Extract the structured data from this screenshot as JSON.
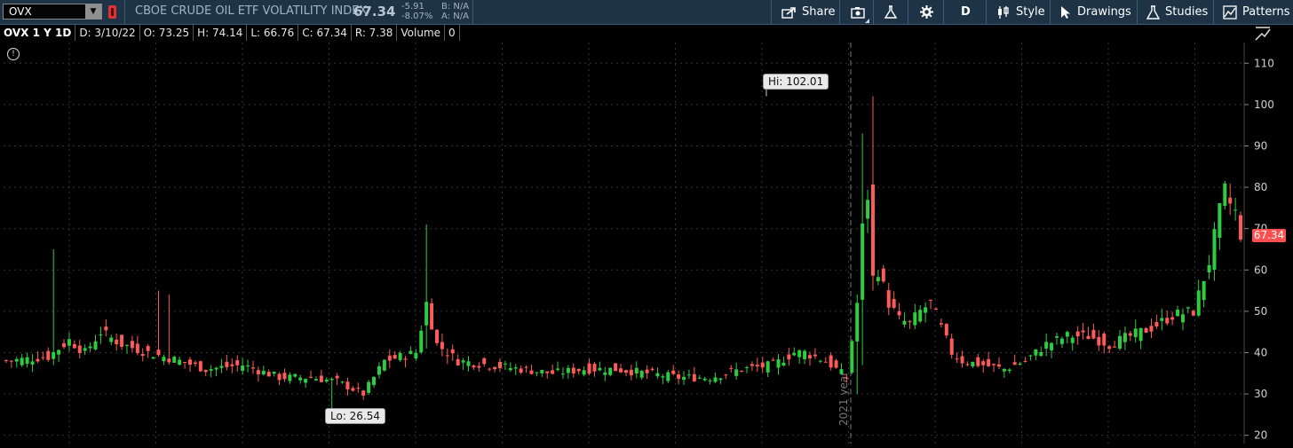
{
  "header": {
    "symbol": "OVX",
    "index_name": "CBOE CRUDE OIL ETF VOLATILITY INDEX",
    "last": "67.34",
    "net_change": "-5.91",
    "pct_change": "-8.07%",
    "bid": "B: N/A",
    "ask": "A: N/A"
  },
  "toolbar": {
    "share": "Share",
    "period": "D",
    "style": "Style",
    "drawings": "Drawings",
    "studies": "Studies",
    "patterns": "Patterns"
  },
  "legend": {
    "title": "OVX 1 Y 1D",
    "date": "D: 3/10/22",
    "open": "O: 73.25",
    "high": "H: 74.14",
    "low": "L: 66.76",
    "close": "C: 67.34",
    "range": "R: 7.38",
    "volume_label": "Volume",
    "volume_value": "0"
  },
  "annotations": {
    "hi": "Hi: 102.01",
    "lo": "Lo: 26.54",
    "year_marker": "2021 year",
    "last_price_tag": "67.34"
  },
  "colors": {
    "up": "#2ecc40",
    "down": "#ff5a5a",
    "background": "#000000",
    "toolbar": "#1e3346"
  },
  "chart_data": {
    "type": "candlestick",
    "title": "OVX 1 Y 1D",
    "ylim": [
      18,
      115
    ],
    "y_ticks": [
      20,
      30,
      40,
      50,
      60,
      70,
      80,
      90,
      100,
      110
    ],
    "grid": true,
    "high": 102.01,
    "low": 26.54,
    "last": 67.34,
    "close_path": [
      [
        0,
        38
      ],
      [
        8,
        39
      ],
      [
        12,
        43
      ],
      [
        15,
        40
      ],
      [
        18,
        45
      ],
      [
        22,
        42
      ],
      [
        27,
        40
      ],
      [
        33,
        38
      ],
      [
        38,
        36
      ],
      [
        45,
        37
      ],
      [
        52,
        34
      ],
      [
        58,
        34
      ],
      [
        63,
        33
      ],
      [
        68,
        30
      ],
      [
        72,
        38
      ],
      [
        78,
        40
      ],
      [
        80,
        52
      ],
      [
        82,
        42
      ],
      [
        86,
        38
      ],
      [
        92,
        37
      ],
      [
        98,
        36
      ],
      [
        104,
        35
      ],
      [
        110,
        36
      ],
      [
        116,
        36
      ],
      [
        122,
        35
      ],
      [
        128,
        34
      ],
      [
        134,
        34
      ],
      [
        140,
        36
      ],
      [
        146,
        37
      ],
      [
        150,
        40
      ],
      [
        152,
        40
      ],
      [
        156,
        38
      ],
      [
        158,
        36
      ],
      [
        160,
        34
      ],
      [
        162,
        52
      ],
      [
        163,
        70
      ],
      [
        164,
        78
      ],
      [
        165,
        58
      ],
      [
        166,
        60
      ],
      [
        168,
        52
      ],
      [
        170,
        48
      ],
      [
        172,
        47
      ],
      [
        174,
        50
      ],
      [
        176,
        52
      ],
      [
        178,
        46
      ],
      [
        180,
        40
      ],
      [
        182,
        38
      ],
      [
        186,
        37
      ],
      [
        190,
        36
      ],
      [
        194,
        38
      ],
      [
        198,
        42
      ],
      [
        202,
        44
      ],
      [
        206,
        44
      ],
      [
        210,
        42
      ],
      [
        214,
        44
      ],
      [
        218,
        46
      ],
      [
        222,
        49
      ],
      [
        226,
        50
      ],
      [
        229,
        62
      ],
      [
        231,
        74
      ],
      [
        232,
        79
      ],
      [
        233,
        76
      ],
      [
        234,
        74
      ],
      [
        235,
        67.34
      ]
    ],
    "spikes": [
      [
        9,
        65,
        38
      ],
      [
        29,
        55,
        39
      ],
      [
        31,
        54,
        39
      ],
      [
        62,
        33,
        26.54
      ],
      [
        80,
        71,
        41
      ],
      [
        163,
        93,
        37
      ],
      [
        165,
        102.01,
        55
      ],
      [
        162,
        30,
        30
      ]
    ]
  }
}
